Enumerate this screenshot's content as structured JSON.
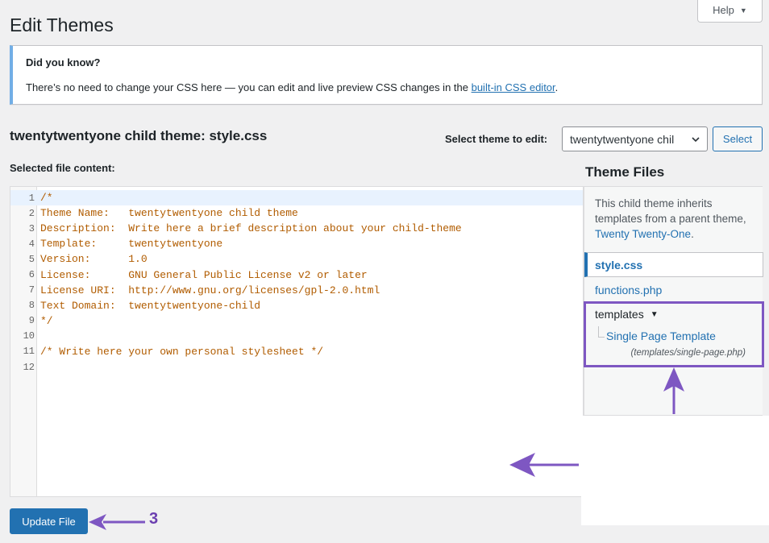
{
  "help_tab": {
    "label": "Help",
    "icon": "triangle-down-icon"
  },
  "page": {
    "title": "Edit Themes"
  },
  "notice": {
    "title": "Did you know?",
    "text_before": "There’s no need to change your CSS here — you can edit and live preview CSS changes in the ",
    "link_text": "built-in CSS editor",
    "text_after": ".",
    "border_color": "#72aee6"
  },
  "editor_header": {
    "file_title": "twentytwentyone child theme: style.css",
    "select_label": "Select theme to edit:",
    "selected_theme": "twentytwentyone chil",
    "select_button": "Select",
    "content_label": "Selected file content:"
  },
  "code": {
    "lines": [
      {
        "n": "1",
        "text": "/*"
      },
      {
        "n": "2",
        "text": "Theme Name:   twentytwentyone child theme"
      },
      {
        "n": "3",
        "text": "Description:  Write here a brief description about your child-theme"
      },
      {
        "n": "4",
        "text": "Template:     twentytwentyone"
      },
      {
        "n": "5",
        "text": "Version:      1.0"
      },
      {
        "n": "6",
        "text": "License:      GNU General Public License v2 or later"
      },
      {
        "n": "7",
        "text": "License URI:  http://www.gnu.org/licenses/gpl-2.0.html"
      },
      {
        "n": "8",
        "text": "Text Domain:  twentytwentyone-child"
      },
      {
        "n": "9",
        "text": "*/"
      },
      {
        "n": "10",
        "text": ""
      },
      {
        "n": "11",
        "text": "/* Write here your own personal stylesheet */"
      },
      {
        "n": "12",
        "text": ""
      }
    ],
    "comment_color": "#b15c00"
  },
  "sidebar": {
    "title": "Theme Files",
    "note_prefix": "This child theme inherits templates from a parent theme, ",
    "parent_link": "Twenty Twenty-One",
    "note_suffix": ".",
    "files": [
      {
        "label": "style.css",
        "current": true
      },
      {
        "label": "functions.php",
        "current": false
      }
    ],
    "templates": {
      "label": "templates",
      "icon": "triangle-down-icon",
      "items": [
        {
          "label": "Single Page Template",
          "path": "(templates/single-page.php)"
        }
      ],
      "highlight_color": "#7e57c2"
    }
  },
  "footer": {
    "update_button": "Update File",
    "step_number": "3"
  },
  "colors": {
    "accent": "#2271b1",
    "annotation": "#7e57c2"
  }
}
